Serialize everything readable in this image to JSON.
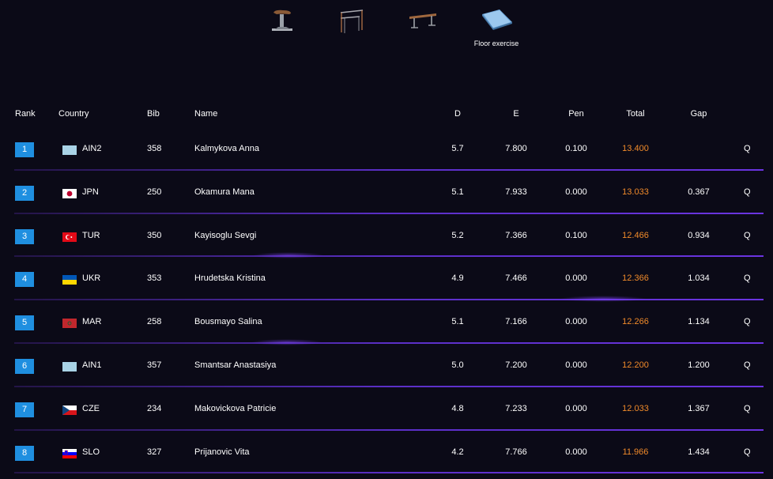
{
  "apparatus": {
    "items": [
      {
        "name": "vault-icon"
      },
      {
        "name": "bars-icon"
      },
      {
        "name": "beam-icon"
      },
      {
        "name": "floor-icon",
        "label": "Floor exercise"
      }
    ]
  },
  "table": {
    "headers": {
      "rank": "Rank",
      "country": "Country",
      "bib": "Bib",
      "name": "Name",
      "d": "D",
      "e": "E",
      "pen": "Pen",
      "total": "Total",
      "gap": "Gap"
    },
    "rows": [
      {
        "rank": "1",
        "country": "AIN2",
        "flag": "ain",
        "bib": "358",
        "name": "Kalmykova Anna",
        "d": "5.7",
        "e": "7.800",
        "pen": "0.100",
        "total": "13.400",
        "gap": "",
        "q": "Q"
      },
      {
        "rank": "2",
        "country": "JPN",
        "flag": "jpn",
        "bib": "250",
        "name": "Okamura Mana",
        "d": "5.1",
        "e": "7.933",
        "pen": "0.000",
        "total": "13.033",
        "gap": "0.367",
        "q": "Q"
      },
      {
        "rank": "3",
        "country": "TUR",
        "flag": "tur",
        "bib": "350",
        "name": "Kayisoglu Sevgi",
        "d": "5.2",
        "e": "7.366",
        "pen": "0.100",
        "total": "12.466",
        "gap": "0.934",
        "q": "Q"
      },
      {
        "rank": "4",
        "country": "UKR",
        "flag": "ukr",
        "bib": "353",
        "name": "Hrudetska Kristina",
        "d": "4.9",
        "e": "7.466",
        "pen": "0.000",
        "total": "12.366",
        "gap": "1.034",
        "q": "Q"
      },
      {
        "rank": "5",
        "country": "MAR",
        "flag": "mar",
        "bib": "258",
        "name": "Bousmayo Salina",
        "d": "5.1",
        "e": "7.166",
        "pen": "0.000",
        "total": "12.266",
        "gap": "1.134",
        "q": "Q"
      },
      {
        "rank": "6",
        "country": "AIN1",
        "flag": "ain",
        "bib": "357",
        "name": "Smantsar Anastasiya",
        "d": "5.0",
        "e": "7.200",
        "pen": "0.000",
        "total": "12.200",
        "gap": "1.200",
        "q": "Q"
      },
      {
        "rank": "7",
        "country": "CZE",
        "flag": "cze",
        "bib": "234",
        "name": "Makovickova Patricie",
        "d": "4.8",
        "e": "7.233",
        "pen": "0.000",
        "total": "12.033",
        "gap": "1.367",
        "q": "Q"
      },
      {
        "rank": "8",
        "country": "SLO",
        "flag": "slo",
        "bib": "327",
        "name": "Prijanovic Vita",
        "d": "4.2",
        "e": "7.766",
        "pen": "0.000",
        "total": "11.966",
        "gap": "1.434",
        "q": "Q"
      }
    ]
  },
  "colors": {
    "background": "#0b0a17",
    "rank_badge": "#1f8fe0",
    "total_text": "#f08a2a",
    "row_divider": "#5b2fc7"
  }
}
